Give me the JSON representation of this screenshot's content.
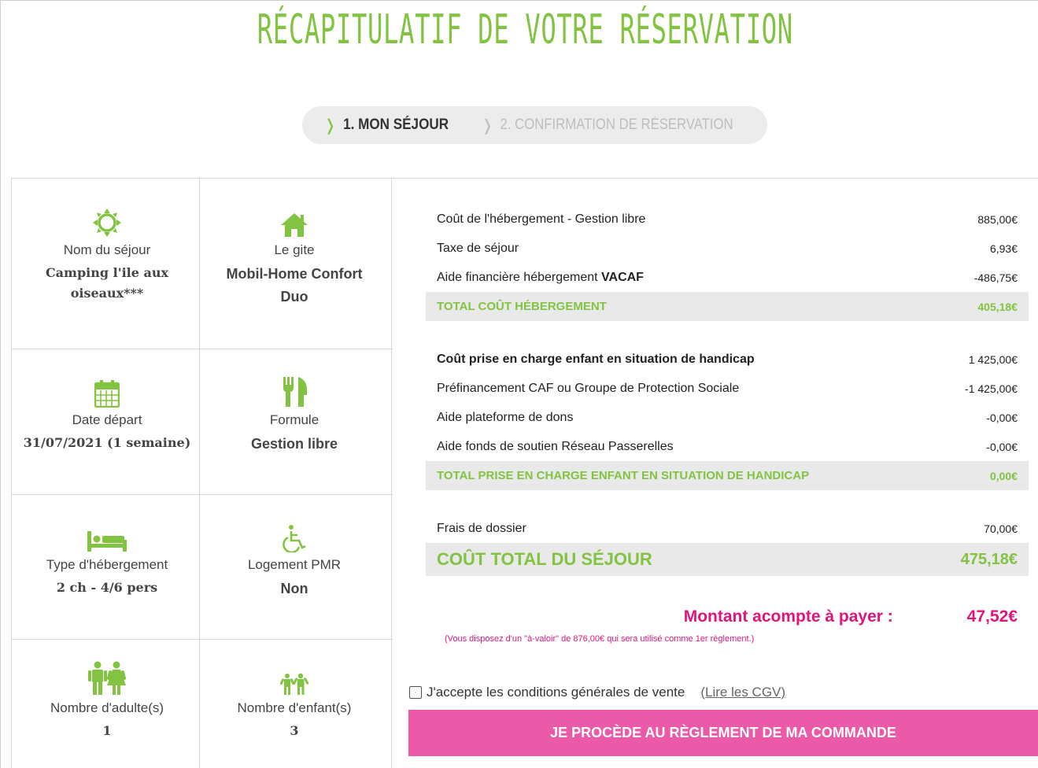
{
  "page_title": "Récapitulatif de votre réservation",
  "steps": [
    {
      "label": "1. MON SÉJOUR",
      "active": true
    },
    {
      "label": "2. CONFIRMATION DE RÉSERVATION",
      "active": false
    }
  ],
  "details": {
    "sejour": {
      "label": "Nom du séjour",
      "value": "Camping l'ile aux oiseaux***"
    },
    "gite": {
      "label": "Le gite",
      "value": "Mobil-Home Confort Duo"
    },
    "date": {
      "label": "Date départ",
      "value": "31/07/2021 (1 semaine)"
    },
    "formule": {
      "label": "Formule",
      "value": "Gestion libre"
    },
    "hebergement": {
      "label": "Type d'hébergement",
      "value": "2 ch - 4/6 pers"
    },
    "pmr": {
      "label": "Logement PMR",
      "value": "Non"
    },
    "adultes": {
      "label": "Nombre d'adulte(s)",
      "value": "1"
    },
    "enfants": {
      "label": "Nombre d'enfant(s)",
      "value": "3"
    }
  },
  "summary": {
    "hebergement": {
      "rows": [
        {
          "label": "Coût de l'hébergement - Gestion libre",
          "amount": "885,00€"
        },
        {
          "label": "Taxe de séjour",
          "amount": "6,93€"
        },
        {
          "label_prefix": "Aide financière hébergement ",
          "label_strong": "VACAF",
          "amount": "-486,75€"
        }
      ],
      "total_label": "TOTAL COÛT HÉBERGEMENT",
      "total_amount": "405,18€"
    },
    "handicap": {
      "rows": [
        {
          "label": "Coût prise en charge enfant en situation de handicap",
          "amount": "1 425,00€"
        },
        {
          "label": "Préfinancement CAF ou Groupe de Protection Sociale",
          "amount": "-1 425,00€"
        },
        {
          "label": "Aide plateforme de dons",
          "amount": "-0,00€"
        },
        {
          "label": "Aide fonds de soutien Réseau Passerelles",
          "amount": "-0,00€"
        }
      ],
      "total_label": "TOTAL PRISE EN CHARGE ENFANT EN SITUATION DE HANDICAP",
      "total_amount": "0,00€"
    },
    "frais": {
      "label": "Frais de dossier",
      "amount": "70,00€"
    },
    "grand_total": {
      "label": "COÛT TOTAL DU SÉJOUR",
      "amount": "475,18€"
    }
  },
  "deposit": {
    "label": "Montant acompte à payer :",
    "amount": "47,52€",
    "note": "(Vous disposez d'un \"à-valoir\" de 876,00€ qui sera utilisé comme 1er règlement.)"
  },
  "terms": {
    "label": "J'accepte les conditions générales de vente",
    "link": "(Lire les CGV)",
    "checked": false
  },
  "pay_button": "JE PROCÈDE AU RÈGLEMENT DE MA COMMANDE",
  "colors": {
    "accent_green": "#82c341",
    "accent_pink": "#e0157c",
    "button_pink": "#ea5aa8"
  }
}
